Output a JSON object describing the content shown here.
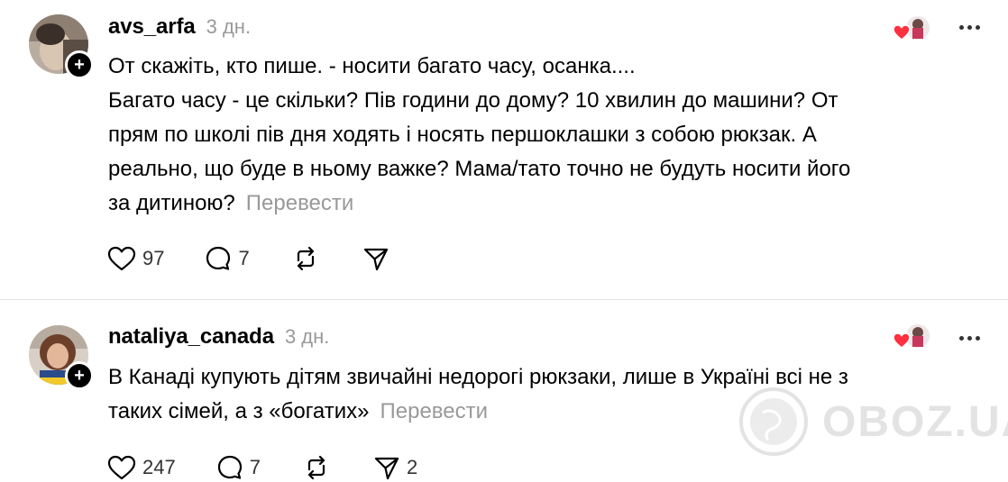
{
  "posts": [
    {
      "username": "avs_arfa",
      "time": "3 дн.",
      "lines": [
        "От скажіть, кто пише. - носити багато часу, осанка....",
        "Багато часу - це скільки? Пів години до дому? 10 хвилин до машини? От",
        "прям по школі пів дня ходять і носять першоклашки з собою рюкзак. А",
        "реально, що буде в ньому важке? Мама/тато точно не будуть носити його",
        "за дитиною?"
      ],
      "translate_label": "Перевести",
      "likes": "97",
      "replies": "7",
      "reposts": "",
      "shares": ""
    },
    {
      "username": "nataliya_canada",
      "time": "3 дн.",
      "lines": [
        "В Канаді купують дітям звичайні недорогі рюкзаки, лише в Україні всі не з",
        "таких сімей, а з «богатих»"
      ],
      "translate_label": "Перевести",
      "likes": "247",
      "replies": "7",
      "reposts": "",
      "shares": "2"
    }
  ],
  "watermark": {
    "text": "OBOZ.UA"
  },
  "icons": {
    "like": "heart-icon",
    "reply": "comment-icon",
    "repost": "repost-icon",
    "share": "send-icon",
    "follow": "plus-icon",
    "more": "more-icon"
  },
  "colors": {
    "text": "#000000",
    "muted": "#999999",
    "heart": "#ff3040",
    "divider": "#e2e2e2"
  }
}
